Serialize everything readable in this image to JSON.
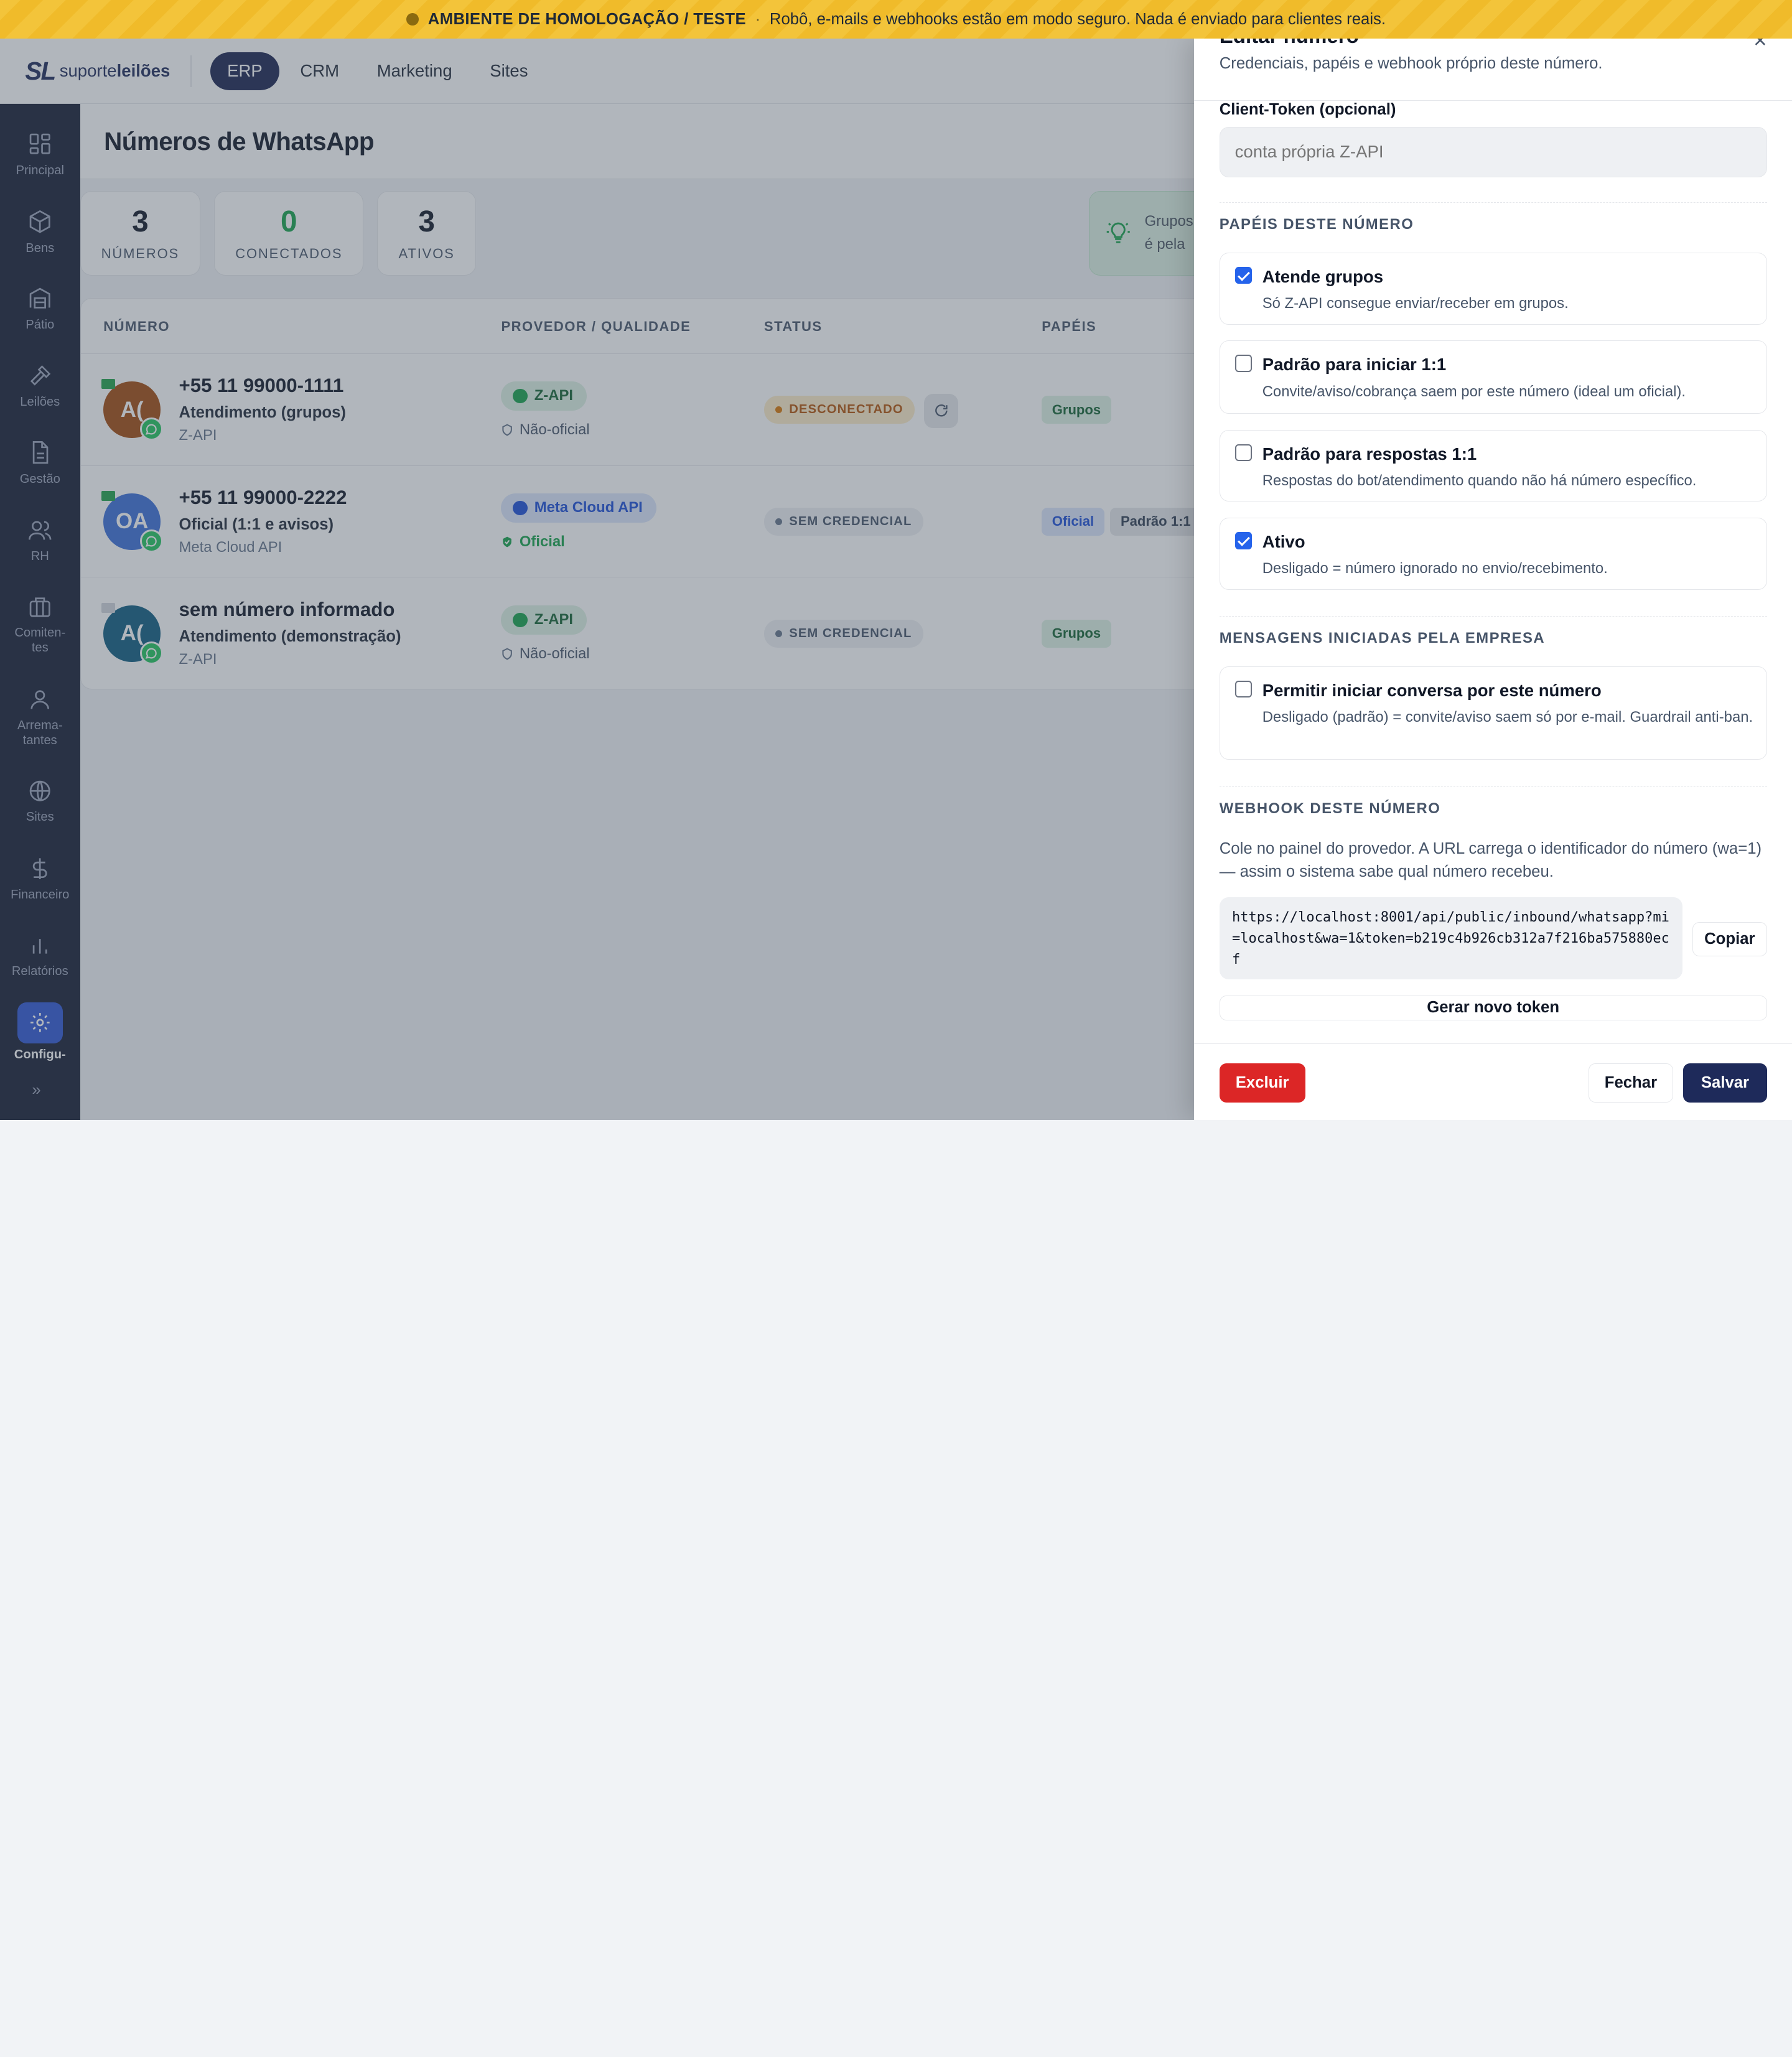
{
  "banner": {
    "title": "AMBIENTE DE HOMOLOGAÇÃO / TESTE",
    "separator": "·",
    "message": "Robô, e-mails e webhooks estão em modo seguro. Nada é enviado para clientes reais."
  },
  "brand": {
    "mark": "SL",
    "word_regular": "suporte",
    "word_bold": "leilões"
  },
  "topnav": {
    "tabs": [
      "ERP",
      "CRM",
      "Marketing",
      "Sites"
    ],
    "active": "ERP"
  },
  "sidebar": {
    "items": [
      {
        "label": "Principal",
        "icon": "grid-icon"
      },
      {
        "label": "Bens",
        "icon": "box-icon"
      },
      {
        "label": "Pátio",
        "icon": "warehouse-icon"
      },
      {
        "label": "Leilões",
        "icon": "gavel-icon"
      },
      {
        "label": "Gestão",
        "icon": "document-icon"
      },
      {
        "label": "RH",
        "icon": "users-icon"
      },
      {
        "label": "Comiten-tes",
        "icon": "briefcase-icon"
      },
      {
        "label": "Arrema-tantes",
        "icon": "user-icon"
      },
      {
        "label": "Sites",
        "icon": "globe-icon"
      },
      {
        "label": "Financeiro",
        "icon": "dollar-icon"
      },
      {
        "label": "Relatórios",
        "icon": "bar-chart-icon"
      },
      {
        "label": "Configu-",
        "icon": "gear-icon"
      }
    ],
    "active": "Configu-",
    "expand_icon": "»"
  },
  "page": {
    "title": "Números de WhatsApp"
  },
  "stats": [
    {
      "value": "3",
      "label": "NÚMEROS"
    },
    {
      "value": "0",
      "label": "CONECTADOS"
    },
    {
      "value": "3",
      "label": "ATIVOS"
    }
  ],
  "hint": {
    "line1": "Grupos",
    "line2": "é pela"
  },
  "table": {
    "headers": [
      "NÚMERO",
      "PROVEDOR / QUALIDADE",
      "STATUS",
      "PAPÉIS"
    ],
    "rows": [
      {
        "number": "+55 11 99000-1111",
        "name": "Atendimento (grupos)",
        "provider": "Z-API",
        "initials": "A(",
        "provider_pill": "Z-API",
        "quality": "Não-oficial",
        "status": "DESCONECTADO",
        "roles": [
          "Grupos"
        ]
      },
      {
        "number": "+55 11 99000-2222",
        "name": "Oficial (1:1 e avisos)",
        "provider": "Meta Cloud API",
        "initials": "OA",
        "provider_pill": "Meta Cloud API",
        "quality": "Oficial",
        "status": "SEM CREDENCIAL",
        "roles": [
          "Oficial",
          "Padrão 1:1"
        ]
      },
      {
        "number": "sem número informado",
        "name": "Atendimento (demonstração)",
        "provider": "Z-API",
        "initials": "A(",
        "provider_pill": "Z-API",
        "quality": "Não-oficial",
        "status": "SEM CREDENCIAL",
        "roles": [
          "Grupos"
        ]
      }
    ]
  },
  "drawer": {
    "title": "Editar número",
    "close": "×",
    "subtitle": "Credenciais, papéis e webhook próprio deste número.",
    "client_token_label": "Client-Token (opcional)",
    "client_token_placeholder": "conta própria Z-API",
    "client_token_value": "",
    "roles_section": "PAPÉIS DESTE NÚMERO",
    "roles": [
      {
        "title": "Atende grupos",
        "desc": "Só Z-API consegue enviar/receber em grupos.",
        "checked": true
      },
      {
        "title": "Padrão para iniciar 1:1",
        "desc": "Convite/aviso/cobrança saem por este número (ideal um oficial).",
        "checked": false
      },
      {
        "title": "Padrão para respostas 1:1",
        "desc": "Respostas do bot/atendimento quando não há número específico.",
        "checked": false
      },
      {
        "title": "Ativo",
        "desc": "Desligado = número ignorado no envio/recebimento.",
        "checked": true
      }
    ],
    "company_section": "MENSAGENS INICIADAS PELA EMPRESA",
    "company_option": {
      "title": "Permitir iniciar conversa por este número",
      "desc": "Desligado (padrão) = convite/aviso saem só por e-mail. Guardrail anti-ban.",
      "checked": false
    },
    "webhook_section": "WEBHOOK DESTE NÚMERO",
    "webhook_desc": "Cole no painel do provedor. A URL carrega o identificador do número (wa=1) — assim o sistema sabe qual número recebeu.",
    "webhook_url": "https://localhost:8001/api/public/inbound/whatsapp?mi=localhost&wa=1&token=b219c4b926cb312a7f216ba575880ecf",
    "copy_label": "Copiar",
    "new_token_label": "Gerar novo token",
    "delete_label": "Excluir",
    "close_label": "Fechar",
    "save_label": "Salvar"
  },
  "colors": {
    "banner": "#f3c43a",
    "nav_active": "#1a2350",
    "sidebar_bg": "#161c33",
    "sidebar_active": "#2f57d4",
    "danger": "#dc2626",
    "primary": "#1e2a5a",
    "checkbox": "#2563eb",
    "success": "#16a34a"
  }
}
